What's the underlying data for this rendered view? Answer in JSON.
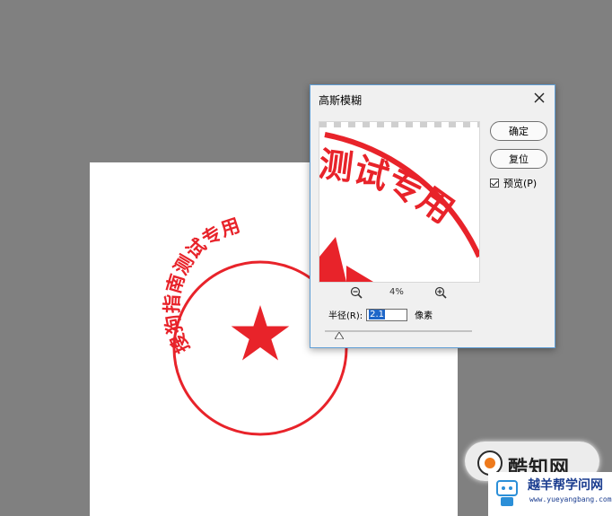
{
  "document": {
    "seal": {
      "text": "搜狗指南测试专用",
      "color": "#e8232a"
    }
  },
  "dialog": {
    "title": "高斯模糊",
    "close_icon": "close-icon",
    "buttons": {
      "ok_label": "确定",
      "reset_label": "复位"
    },
    "preview_checkbox": {
      "label": "预览(P)",
      "checked": true
    },
    "preview_text": "测试专用",
    "zoom": {
      "level": "4%",
      "zoom_out_icon": "zoom-out-icon",
      "zoom_in_icon": "zoom-in-icon"
    },
    "radius": {
      "label": "半径(R):",
      "value": "2.1",
      "unit": "像素",
      "slider_fraction": 0.1
    }
  },
  "watermark": {
    "brand": "酷知网",
    "site_title": "越羊帮学问网",
    "site_url": "www.yueyangbang.com"
  }
}
